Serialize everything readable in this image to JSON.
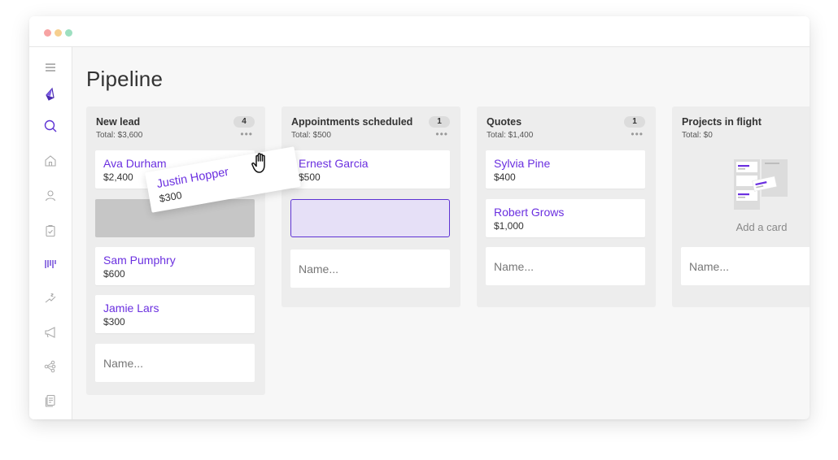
{
  "window": {
    "controls": [
      "close",
      "minimize",
      "maximize"
    ]
  },
  "sidebar": {
    "items": [
      {
        "icon": "menu-icon"
      },
      {
        "icon": "logo-icon"
      },
      {
        "icon": "search-icon"
      },
      {
        "icon": "home-icon"
      },
      {
        "icon": "person-icon"
      },
      {
        "icon": "clipboard-check-icon"
      },
      {
        "icon": "pipeline-icon"
      },
      {
        "icon": "money-trend-icon"
      },
      {
        "icon": "megaphone-icon"
      },
      {
        "icon": "network-icon"
      },
      {
        "icon": "document-icon"
      }
    ],
    "active_item": "pipeline-icon",
    "accent_color": "#5e33d4"
  },
  "page": {
    "title": "Pipeline"
  },
  "colors": {
    "accent": "#6b30e0",
    "column_bg": "#ededed",
    "drop_target_bg": "#e6e0f7",
    "slot_bg": "#c6c6c6"
  },
  "columns": [
    {
      "name": "New lead",
      "total": "Total: $3,600",
      "count": "4",
      "more": "•••",
      "cards": [
        {
          "name": "Ava Durham",
          "amount": "$2,400"
        },
        {
          "name": "Sam Pumphry",
          "amount": "$600"
        },
        {
          "name": "Jamie Lars",
          "amount": "$300"
        }
      ],
      "input_placeholder": "Name..."
    },
    {
      "name": "Appointments scheduled",
      "total": "Total: $500",
      "count": "1",
      "more": "•••",
      "cards": [
        {
          "name": "Ernest Garcia",
          "amount": "$500"
        }
      ],
      "input_placeholder": "Name..."
    },
    {
      "name": "Quotes",
      "total": "Total: $1,400",
      "count": "1",
      "more": "•••",
      "cards": [
        {
          "name": "Sylvia Pine",
          "amount": "$400"
        },
        {
          "name": "Robert Grows",
          "amount": "$1,000"
        }
      ],
      "input_placeholder": "Name..."
    },
    {
      "name": "Projects in flight",
      "total": "Total: $0",
      "empty_label": "Add a card",
      "input_placeholder": "Name..."
    }
  ],
  "dragging_card": {
    "name": "Justin Hopper",
    "amount": "$300"
  },
  "cursor": "grab-hand-icon"
}
